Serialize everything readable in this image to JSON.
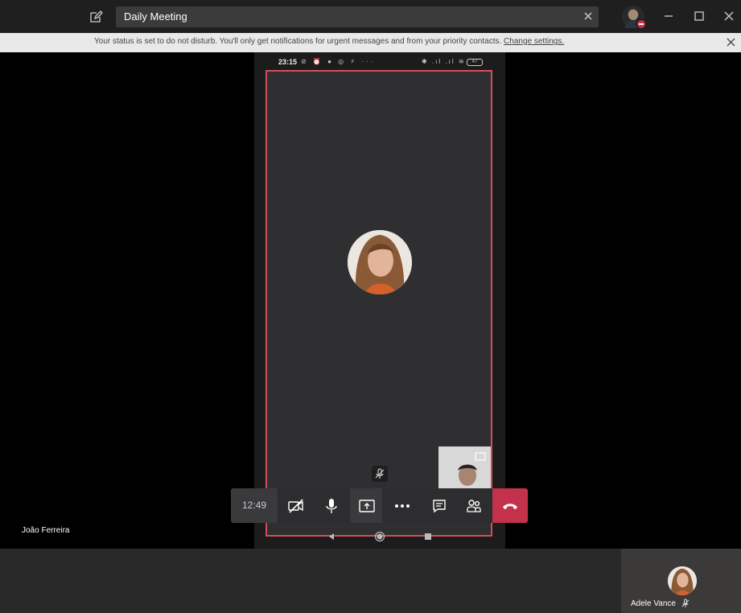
{
  "titlebar": {
    "search_value": "Daily Meeting"
  },
  "notification": {
    "message": "Your status is set to do not disturb. You'll only get notifications for urgent messages and from your priority contacts.",
    "link": "Change settings."
  },
  "phone": {
    "status_time": "23:15",
    "battery": "47"
  },
  "call": {
    "timer": "12:49",
    "presenter_name": "João Ferreira"
  },
  "participants": [
    {
      "name": "Adele Vance"
    }
  ],
  "colors": {
    "accent_hangup": "#c4314b",
    "dnd": "#c4314b",
    "share_border": "#d0505a"
  }
}
